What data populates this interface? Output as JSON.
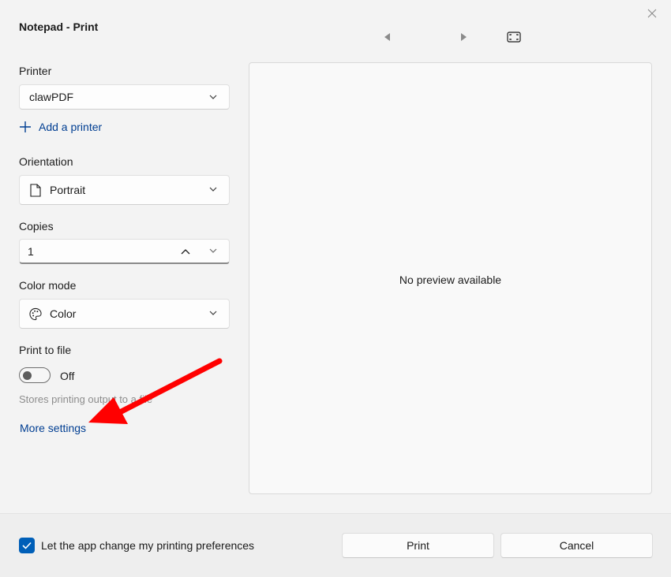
{
  "window": {
    "title": "Notepad - Print",
    "close_icon": "close-icon"
  },
  "preview_nav": {
    "prev_icon": "triangle-left-icon",
    "next_icon": "triangle-right-icon",
    "fit_icon": "fit-page-icon"
  },
  "printer": {
    "label": "Printer",
    "value": "clawPDF",
    "add_label": "Add a printer"
  },
  "orientation": {
    "label": "Orientation",
    "value": "Portrait",
    "icon": "document-icon"
  },
  "copies": {
    "label": "Copies",
    "value": "1"
  },
  "color_mode": {
    "label": "Color mode",
    "value": "Color",
    "icon": "palette-icon"
  },
  "print_to_file": {
    "label": "Print to file",
    "state": "Off",
    "description": "Stores printing output to a file",
    "on": false
  },
  "more_settings": "More settings",
  "preview": {
    "message": "No preview available"
  },
  "footer": {
    "checkbox_label": "Let the app change my printing preferences",
    "checkbox_checked": true,
    "print_label": "Print",
    "cancel_label": "Cancel"
  },
  "colors": {
    "accent": "#005fb8",
    "link": "#003e92",
    "annotation_arrow": "#ff0000"
  }
}
